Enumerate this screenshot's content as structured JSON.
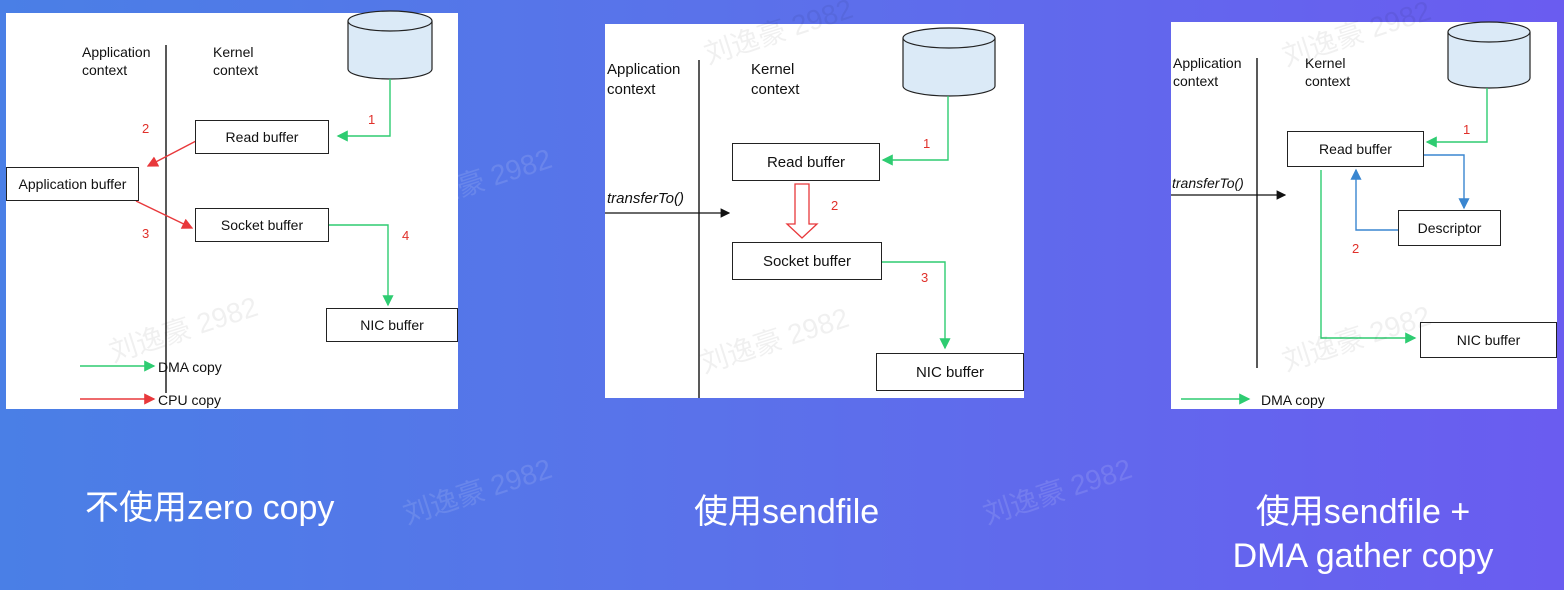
{
  "panel1": {
    "app_context": "Application\ncontext",
    "kernel_context": "Kernel\ncontext",
    "read_buffer": "Read buffer",
    "application_buffer": "Application buffer",
    "socket_buffer": "Socket buffer",
    "nic_buffer": "NIC buffer",
    "n1": "1",
    "n2": "2",
    "n3": "3",
    "n4": "4",
    "legend_dma": "DMA copy",
    "legend_cpu": "CPU copy",
    "caption": "不使用zero copy"
  },
  "panel2": {
    "app_context": "Application\ncontext",
    "kernel_context": "Kernel\ncontext",
    "transfer": "transferTo()",
    "read_buffer": "Read buffer",
    "socket_buffer": "Socket buffer",
    "nic_buffer": "NIC buffer",
    "n1": "1",
    "n2": "2",
    "n3": "3",
    "caption": "使用sendfile"
  },
  "panel3": {
    "app_context": "Application\ncontext",
    "kernel_context": "Kernel\ncontext",
    "transfer": "transferTo()",
    "read_buffer": "Read buffer",
    "descriptor": "Descriptor",
    "nic_buffer": "NIC buffer",
    "n1": "1",
    "n2": "2",
    "legend_dma": "DMA copy",
    "caption_line1": "使用sendfile +",
    "caption_line2": "DMA gather copy"
  },
  "watermark": "刘逸豪 2982",
  "colors": {
    "dma": "#2ecc71",
    "cpu": "#e8383b",
    "blue": "#3a86d0",
    "disk_fill": "#dbeaf7"
  }
}
